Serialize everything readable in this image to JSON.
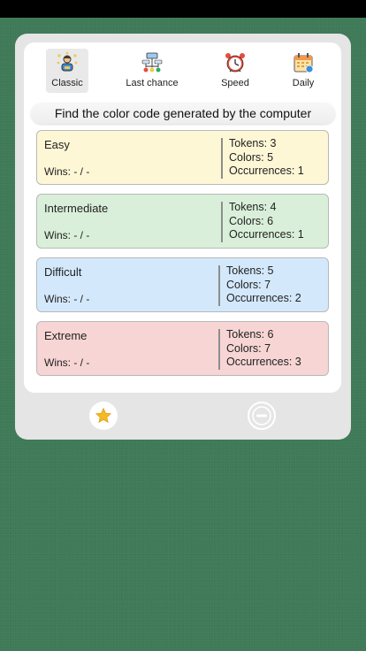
{
  "tabs": [
    {
      "label": "Classic",
      "icon": "player-icon"
    },
    {
      "label": "Last chance",
      "icon": "tree-icon"
    },
    {
      "label": "Speed",
      "icon": "alarm-clock-icon"
    },
    {
      "label": "Daily",
      "icon": "calendar-icon"
    }
  ],
  "heading": "Find the color code generated by the computer",
  "levels": [
    {
      "name": "Easy",
      "wins": "Wins: -  /  -",
      "tokens": "Tokens: 3",
      "colors": "Colors: 5",
      "occurrences": "Occurrences: 1",
      "color": "#fdf7d6"
    },
    {
      "name": "Intermediate",
      "wins": "Wins: -  /  -",
      "tokens": "Tokens: 4",
      "colors": "Colors: 6",
      "occurrences": "Occurrences: 1",
      "color": "#d9efd9"
    },
    {
      "name": "Difficult",
      "wins": "Wins: -  /  -",
      "tokens": "Tokens: 5",
      "colors": "Colors: 7",
      "occurrences": "Occurrences: 2",
      "color": "#d3e8fb"
    },
    {
      "name": "Extreme",
      "wins": "Wins: -  /  -",
      "tokens": "Tokens: 6",
      "colors": "Colors: 7",
      "occurrences": "Occurrences: 3",
      "color": "#f6d5d4"
    }
  ],
  "bottom": {
    "favorite_icon": "star-icon",
    "remove_icon": "minus-circle-icon"
  }
}
